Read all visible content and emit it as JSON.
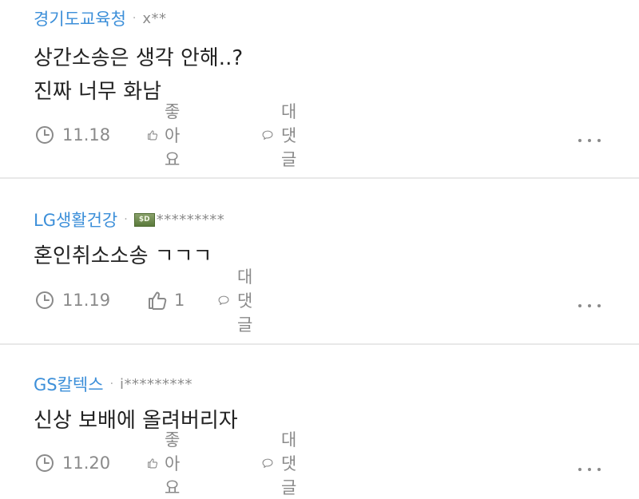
{
  "comments": [
    {
      "company": "경기도교육청",
      "separator": "·",
      "user": "x**",
      "badge": "",
      "lines": [
        "상간소송은 생각 안해..?",
        "진짜 너무 화남"
      ],
      "date": "11.18",
      "like": "좋아요",
      "reply": "대댓글"
    },
    {
      "company": "LG생활건강",
      "separator": "·",
      "user": "*********",
      "badge": "$D",
      "lines": [
        "혼인취소소송 ㄱㄱㄱ"
      ],
      "date": "11.19",
      "like": "1",
      "reply": "대댓글"
    },
    {
      "company": "GS칼텍스",
      "separator": "·",
      "user": "i*********",
      "badge": "",
      "lines": [
        "신상 보배에 올려버리자"
      ],
      "date": "11.20",
      "like": "좋아요",
      "reply": "대댓글"
    }
  ],
  "icons": {
    "time": "clock-icon",
    "like": "thumbs-up-icon",
    "reply": "speech-bubble-icon",
    "more": "more-dots-icon"
  },
  "colors": {
    "company": "#3c8fd9",
    "text": "#222222",
    "muted": "#8a8a8a",
    "divider": "#e8e8e8"
  }
}
